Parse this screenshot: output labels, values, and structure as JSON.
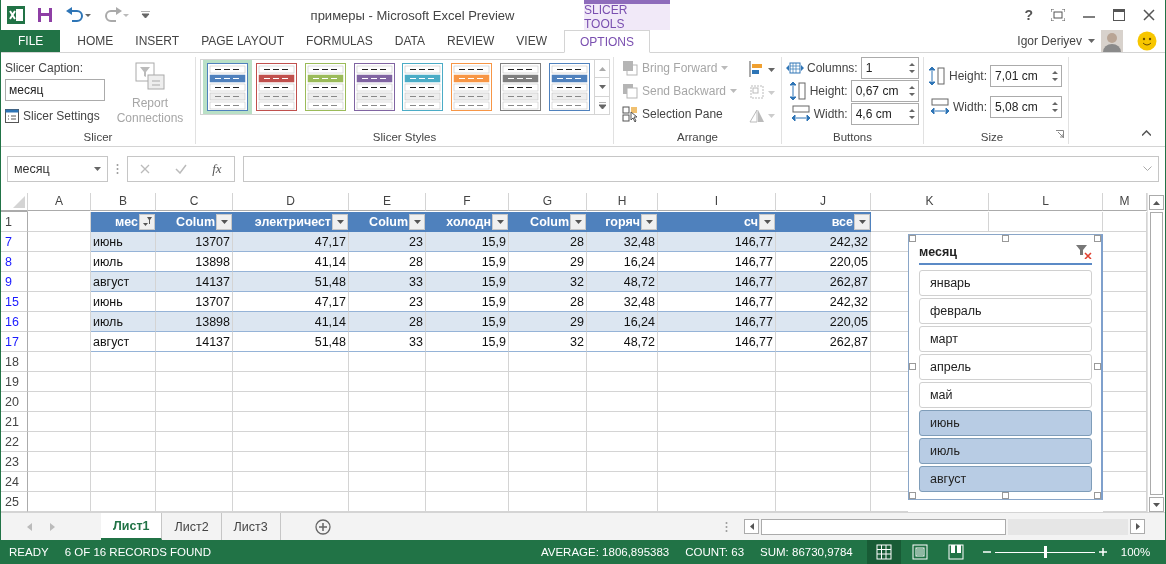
{
  "window": {
    "title": "примеры - Microsoft Excel Preview",
    "context_tab": "SLICER TOOLS",
    "help": "?"
  },
  "ribbon_tabs": [
    {
      "label": "FILE",
      "kind": "file",
      "selected": false
    },
    {
      "label": "HOME",
      "kind": "normal",
      "selected": false
    },
    {
      "label": "INSERT",
      "kind": "normal",
      "selected": false
    },
    {
      "label": "PAGE LAYOUT",
      "kind": "normal",
      "selected": false
    },
    {
      "label": "FORMULAS",
      "kind": "normal",
      "selected": false
    },
    {
      "label": "DATA",
      "kind": "normal",
      "selected": false
    },
    {
      "label": "REVIEW",
      "kind": "normal",
      "selected": false
    },
    {
      "label": "VIEW",
      "kind": "normal",
      "selected": false
    },
    {
      "label": "OPTIONS",
      "kind": "context",
      "selected": true
    }
  ],
  "user": {
    "name": "Igor Deriyev"
  },
  "ribbon": {
    "slicer": {
      "title": "Slicer",
      "caption_label": "Slicer Caption:",
      "caption_value": "месяц",
      "settings": "Slicer Settings",
      "report_connections": "Report Connections",
      "report_disabled": true
    },
    "styles": {
      "title": "Slicer Styles",
      "items": [
        {
          "color": "#4f81bd",
          "selected": true
        },
        {
          "color": "#c0504d",
          "selected": false
        },
        {
          "color": "#9bbb59",
          "selected": false
        },
        {
          "color": "#8064a2",
          "selected": false
        },
        {
          "color": "#4bacc6",
          "selected": false
        },
        {
          "color": "#f79646",
          "selected": false
        },
        {
          "color": "#7f7f7f",
          "selected": false
        },
        {
          "color": "#4f81bd",
          "selected": false
        }
      ]
    },
    "arrange": {
      "title": "Arrange",
      "items": [
        {
          "label": "Bring Forward",
          "kind": "bring",
          "disabled": true
        },
        {
          "label": "Send Backward",
          "kind": "send",
          "disabled": true
        },
        {
          "label": "Selection Pane",
          "kind": "pane",
          "disabled": false
        }
      ]
    },
    "buttons": {
      "title": "Buttons",
      "fields": [
        {
          "label": "Columns:",
          "value": "1",
          "kind": "columns"
        },
        {
          "label": "Height:",
          "value": "0,67 cm",
          "kind": "height"
        },
        {
          "label": "Width:",
          "value": "4,6 cm",
          "kind": "width"
        }
      ]
    },
    "size": {
      "title": "Size",
      "fields": [
        {
          "label": "Height:",
          "value": "7,01 cm",
          "kind": "height"
        },
        {
          "label": "Width:",
          "value": "5,08 cm",
          "kind": "width"
        }
      ]
    }
  },
  "formula_bar": {
    "name_box": "месяц",
    "function_label": "fx"
  },
  "sheet": {
    "columns": [
      "A",
      "B",
      "C",
      "D",
      "E",
      "F",
      "G",
      "H",
      "I",
      "J",
      "K",
      "L",
      "M"
    ],
    "table_headers": [
      {
        "text": "мес",
        "filtered": true
      },
      {
        "text": "Colum",
        "filtered": false
      },
      {
        "text": "электричест",
        "filtered": false
      },
      {
        "text": "Colum",
        "filtered": false
      },
      {
        "text": "холодн",
        "filtered": false
      },
      {
        "text": "Colum",
        "filtered": false
      },
      {
        "text": "горяч",
        "filtered": false
      },
      {
        "text": "сч",
        "filtered": false
      },
      {
        "text": "все",
        "filtered": false
      }
    ],
    "header_row": "1",
    "rows": [
      {
        "number": "7",
        "filtered": true,
        "cells": [
          "июнь",
          "13707",
          "47,17",
          "23",
          "15,9",
          "28",
          "32,48",
          "146,77",
          "242,32"
        ]
      },
      {
        "number": "8",
        "filtered": true,
        "cells": [
          "июль",
          "13898",
          "41,14",
          "28",
          "15,9",
          "29",
          "16,24",
          "146,77",
          "220,05"
        ]
      },
      {
        "number": "9",
        "filtered": true,
        "cells": [
          "август",
          "14137",
          "51,48",
          "33",
          "15,9",
          "32",
          "48,72",
          "146,77",
          "262,87"
        ]
      },
      {
        "number": "15",
        "filtered": true,
        "cells": [
          "июнь",
          "13707",
          "47,17",
          "23",
          "15,9",
          "28",
          "32,48",
          "146,77",
          "242,32"
        ]
      },
      {
        "number": "16",
        "filtered": true,
        "cells": [
          "июль",
          "13898",
          "41,14",
          "28",
          "15,9",
          "29",
          "16,24",
          "146,77",
          "220,05"
        ]
      },
      {
        "number": "17",
        "filtered": true,
        "cells": [
          "август",
          "14137",
          "51,48",
          "33",
          "15,9",
          "32",
          "48,72",
          "146,77",
          "262,87"
        ]
      },
      {
        "number": "18",
        "filtered": false
      },
      {
        "number": "19",
        "filtered": false
      },
      {
        "number": "20",
        "filtered": false
      },
      {
        "number": "21",
        "filtered": false
      },
      {
        "number": "22",
        "filtered": false
      },
      {
        "number": "23",
        "filtered": false
      },
      {
        "number": "24",
        "filtered": false
      },
      {
        "number": "25",
        "filtered": false
      }
    ]
  },
  "slicer": {
    "title": "месяц",
    "items": [
      {
        "label": "январь",
        "selected": false
      },
      {
        "label": "февраль",
        "selected": false
      },
      {
        "label": "март",
        "selected": false
      },
      {
        "label": "апрель",
        "selected": false
      },
      {
        "label": "май",
        "selected": false
      },
      {
        "label": "июнь",
        "selected": true
      },
      {
        "label": "июль",
        "selected": true
      },
      {
        "label": "август",
        "selected": true
      }
    ]
  },
  "sheet_tabs": [
    {
      "label": "Лист1",
      "selected": true
    },
    {
      "label": "Лист2",
      "selected": false
    },
    {
      "label": "Лист3",
      "selected": false
    }
  ],
  "status_bar": {
    "mode": "READY",
    "records": "6 OF 16 RECORDS FOUND",
    "average": "AVERAGE: 1806,895383",
    "count": "COUNT: 63",
    "sum": "SUM: 86730,9784",
    "views": [
      {
        "kind": "normal",
        "selected": true
      },
      {
        "kind": "layout",
        "selected": false
      },
      {
        "kind": "break",
        "selected": false
      }
    ],
    "zoom": {
      "level": 0.5,
      "label": "100%"
    }
  }
}
